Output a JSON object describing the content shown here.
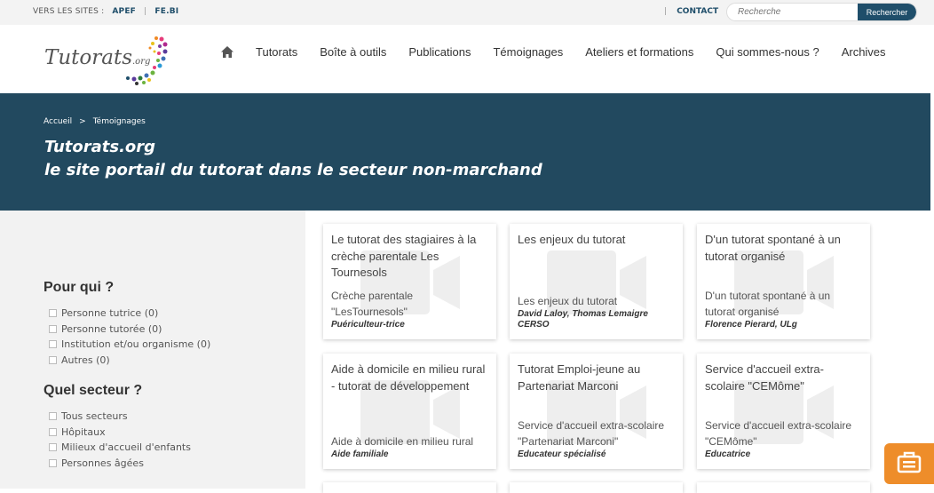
{
  "topbar": {
    "sites_label": "VERS LES SITES :",
    "sites": [
      "APEF",
      "FE.BI"
    ],
    "separator": "|",
    "contact": "CONTACT",
    "search_placeholder": "Recherche",
    "search_button": "Rechercher"
  },
  "logo": {
    "text": "Tutorats",
    "suffix": ".org"
  },
  "nav": {
    "home_icon": "home-icon",
    "items": [
      "Tutorats",
      "Boîte à outils",
      "Publications",
      "Témoignages",
      "Ateliers et formations",
      "Qui sommes-nous ?",
      "Archives"
    ]
  },
  "hero": {
    "breadcrumb": [
      "Accueil",
      "Témoignages"
    ],
    "breadcrumb_sep": ">",
    "title_line1": "Tutorats.org",
    "title_line2": "le site portail du tutorat dans le secteur non-marchand"
  },
  "filters": {
    "pour_qui": {
      "title": "Pour qui ?",
      "items": [
        "Personne tutrice (0)",
        "Personne tutorée (0)",
        "Institution et/ou organisme (0)",
        "Autres (0)"
      ]
    },
    "secteur": {
      "title": "Quel secteur ?",
      "items": [
        "Tous secteurs",
        "Hôpitaux",
        "Milieux d'accueil d'enfants",
        "Personnes âgées"
      ]
    }
  },
  "cards": [
    {
      "title": "Le tutorat des stagiaires à la crèche parentale Les Tournesols",
      "subtitle": "Crèche parentale \"LesTournesols\"",
      "authors": "",
      "role": "Puériculteur-trice"
    },
    {
      "title": "Les enjeux du tutorat",
      "subtitle": "Les enjeux du tutorat",
      "authors": "David Laloy, Thomas Lemaigre",
      "role": "CERSO"
    },
    {
      "title": "D'un tutorat spontané à un tutorat organisé",
      "subtitle": "D'un tutorat spontané à un tutorat organisé",
      "authors": "",
      "role": "Florence Pierard, ULg"
    },
    {
      "title": "Aide à domicile en milieu rural - tutorat de développement",
      "subtitle": "Aide à domicile en milieu rural",
      "authors": "",
      "role": "Aide familiale"
    },
    {
      "title": "Tutorat Emploi-jeune au Partenariat Marconi",
      "subtitle": "Service d'accueil extra-scolaire \"Partenariat Marconi\"",
      "authors": "",
      "role": "Educateur spécialisé"
    },
    {
      "title": "Service d'accueil extra-scolaire \"CEMôme\"",
      "subtitle": "Service d'accueil extra-scolaire \"CEMôme\"",
      "authors": "",
      "role": "Educatrice"
    }
  ],
  "chat_icon": "chat-icon",
  "colors": {
    "brand": "#22495f",
    "accent": "#ee8d2a",
    "sidebar_bg": "#f2f2f2"
  }
}
